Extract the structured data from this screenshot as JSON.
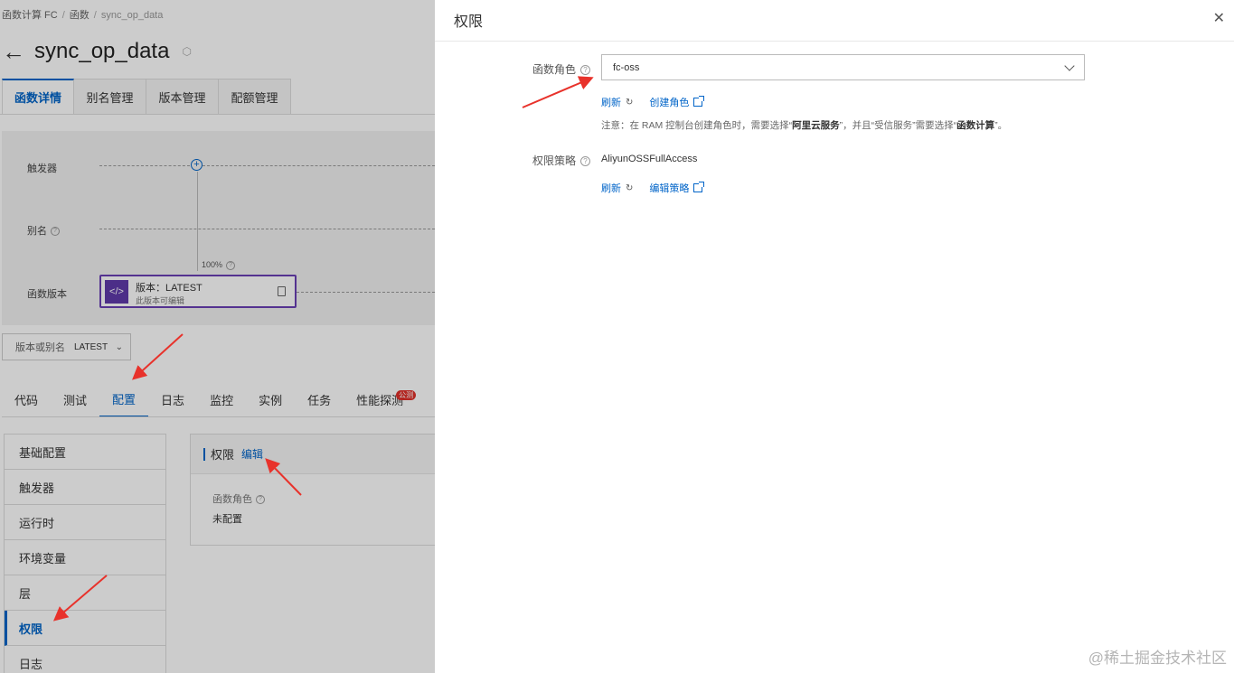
{
  "breadcrumb": {
    "items": [
      "函数计算 FC",
      "函数"
    ],
    "current": "sync_op_data"
  },
  "header": {
    "title": "sync_op_data"
  },
  "top_tabs": [
    {
      "label": "函数详情",
      "active": true
    },
    {
      "label": "别名管理",
      "active": false
    },
    {
      "label": "版本管理",
      "active": false
    },
    {
      "label": "配额管理",
      "active": false
    }
  ],
  "diagram": {
    "trigger_label": "触发器",
    "alias_label": "别名",
    "version_label": "函数版本",
    "percent": "100%",
    "card_title": "版本：LATEST",
    "card_sub": "此版本可编辑"
  },
  "version_select": {
    "label": "版本或别名",
    "value": "LATEST"
  },
  "sub_tabs": [
    {
      "label": "代码",
      "active": false
    },
    {
      "label": "测试",
      "active": false
    },
    {
      "label": "配置",
      "active": true
    },
    {
      "label": "日志",
      "active": false
    },
    {
      "label": "监控",
      "active": false
    },
    {
      "label": "实例",
      "active": false
    },
    {
      "label": "任务",
      "active": false
    },
    {
      "label": "性能探测",
      "active": false
    }
  ],
  "beta_badge": "公测",
  "side_menu": [
    {
      "label": "基础配置",
      "active": false
    },
    {
      "label": "触发器",
      "active": false
    },
    {
      "label": "运行时",
      "active": false
    },
    {
      "label": "环境变量",
      "active": false
    },
    {
      "label": "层",
      "active": false
    },
    {
      "label": "权限",
      "active": true
    },
    {
      "label": "日志",
      "active": false
    }
  ],
  "perm_card": {
    "title": "权限",
    "edit": "编辑",
    "role_label": "函数角色",
    "role_value": "未配置"
  },
  "drawer": {
    "title": "权限",
    "role_label": "函数角色",
    "role_value": "fc-oss",
    "refresh": "刷新",
    "create_role": "创建角色",
    "note_prefix": "注意：在 RAM 控制台创建角色时，需要选择“",
    "note_b1": "阿里云服务",
    "note_mid": "”，并且“受信服务”需要选择“",
    "note_b2": "函数计算",
    "note_suffix": "”。",
    "policy_label": "权限策略",
    "policy_value": "AliyunOSSFullAccess",
    "edit_policy": "编辑策略"
  },
  "watermark": "@稀土掘金技术社区",
  "colors": {
    "primary": "#0064c8",
    "annotation_arrow": "#e8322b",
    "version_card": "#5f3aab"
  }
}
